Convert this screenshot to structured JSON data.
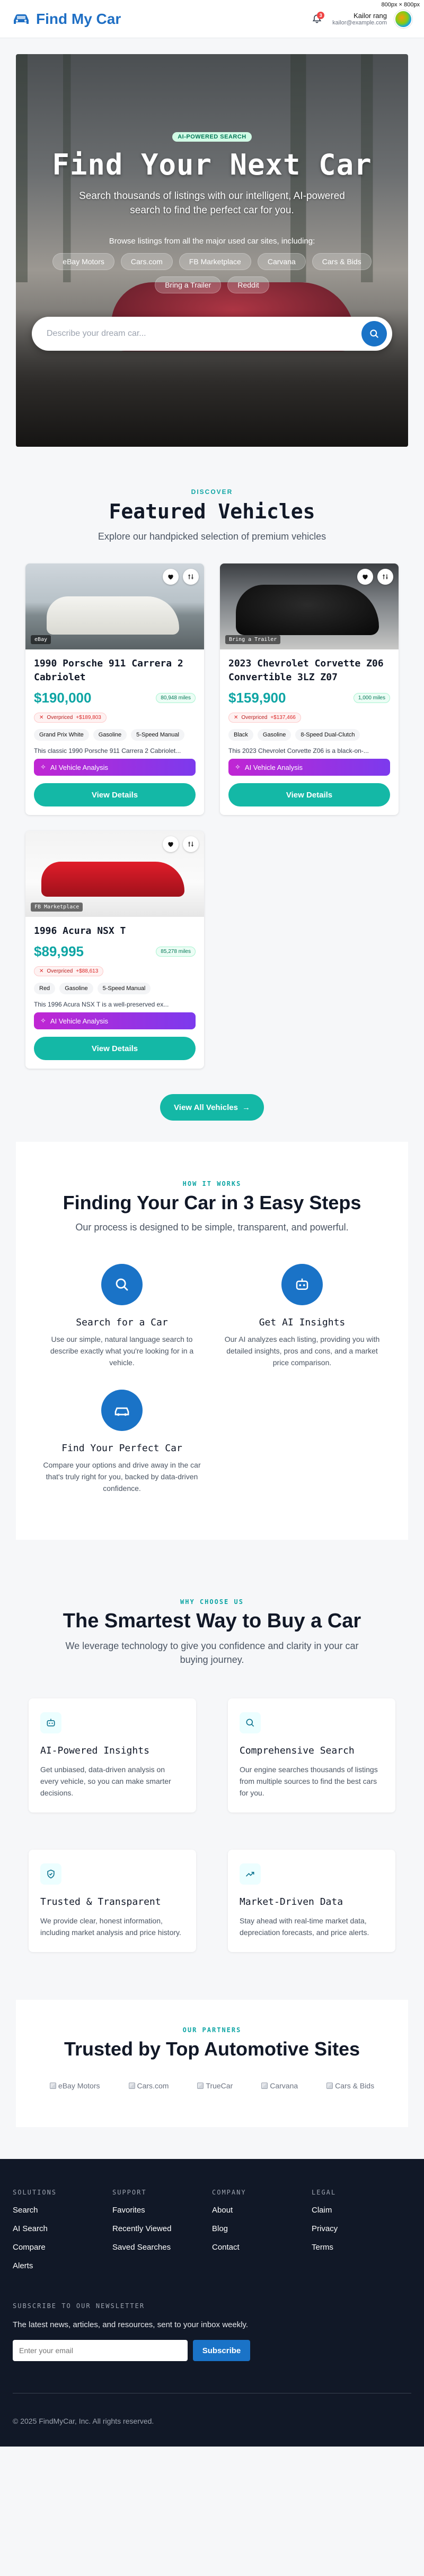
{
  "header": {
    "brand": "Find My Car",
    "notifications_count": "3",
    "user_name": "Kailor rang",
    "user_email": "kailor@example.com",
    "dim_note": "800px × 800px"
  },
  "hero": {
    "badge": "AI-POWERED SEARCH",
    "title": "Find Your Next Car",
    "subtitle": "Search thousands of listings with our intelligent, AI-powered search to find the perfect car for you.",
    "browse_label": "Browse listings from all the major used car sites, including:",
    "sites": [
      "eBay Motors",
      "Cars.com",
      "FB Marketplace",
      "Carvana",
      "Cars & Bids",
      "Bring a Trailer",
      "Reddit"
    ],
    "search_placeholder": "Describe your dream car..."
  },
  "featured": {
    "eyebrow": "DISCOVER",
    "title": "Featured Vehicles",
    "subtitle": "Explore our handpicked selection of premium vehicles",
    "ai_label": "AI Vehicle Analysis",
    "view_label": "View Details",
    "view_all": "View All Vehicles",
    "cars": [
      {
        "source": "eBay",
        "title": "1990 Porsche 911 Carrera 2 Cabriolet",
        "price": "$190,000",
        "miles": "80,948 miles",
        "overpriced": "Overpriced",
        "over_amount": "+$189,803",
        "tags": [
          "Grand Prix White",
          "Gasoline",
          "5-Speed Manual"
        ],
        "desc": "This classic 1990 Porsche 911 Carrera 2 Cabriolet..."
      },
      {
        "source": "Bring a Trailer",
        "title": "2023 Chevrolet Corvette Z06 Convertible 3LZ Z07",
        "price": "$159,900",
        "miles": "1,000 miles",
        "overpriced": "Overpriced",
        "over_amount": "+$137,466",
        "tags": [
          "Black",
          "Gasoline",
          "8-Speed Dual-Clutch"
        ],
        "desc": "This 2023 Chevrolet Corvette Z06 is a black-on-..."
      },
      {
        "source": "FB Marketplace",
        "title": "1996 Acura NSX T",
        "price": "$89,995",
        "miles": "85,278 miles",
        "overpriced": "Overpriced",
        "over_amount": "+$88,613",
        "tags": [
          "Red",
          "Gasoline",
          "5-Speed Manual"
        ],
        "desc": "This 1996 Acura NSX T is a well-preserved ex..."
      }
    ]
  },
  "how": {
    "eyebrow": "HOW IT WORKS",
    "title": "Finding Your Car in 3 Easy Steps",
    "subtitle": "Our process is designed to be simple, transparent, and powerful.",
    "steps": [
      {
        "title": "Search for a Car",
        "text": "Use our simple, natural language search to describe exactly what you're looking for in a vehicle."
      },
      {
        "title": "Get AI Insights",
        "text": "Our AI analyzes each listing, providing you with detailed insights, pros and cons, and a market price comparison."
      },
      {
        "title": "Find Your Perfect Car",
        "text": "Compare your options and drive away in the car that's truly right for you, backed by data-driven confidence."
      }
    ]
  },
  "why": {
    "eyebrow": "WHY CHOOSE US",
    "title": "The Smartest Way to Buy a Car",
    "subtitle": "We leverage technology to give you confidence and clarity in your car buying journey.",
    "features": [
      {
        "title": "AI-Powered Insights",
        "text": "Get unbiased, data-driven analysis on every vehicle, so you can make smarter decisions."
      },
      {
        "title": "Comprehensive Search",
        "text": "Our engine searches thousands of listings from multiple sources to find the best cars for you."
      },
      {
        "title": "Trusted & Transparent",
        "text": "We provide clear, honest information, including market analysis and price history."
      },
      {
        "title": "Market-Driven Data",
        "text": "Stay ahead with real-time market data, depreciation forecasts, and price alerts."
      }
    ]
  },
  "partners": {
    "eyebrow": "OUR PARTNERS",
    "title": "Trusted by Top Automotive Sites",
    "logos": [
      "eBay Motors",
      "Cars.com",
      "TrueCar",
      "Carvana",
      "Cars & Bids"
    ]
  },
  "footer": {
    "cols": [
      {
        "title": "SOLUTIONS",
        "links": [
          "Search",
          "AI Search",
          "Compare",
          "Alerts"
        ]
      },
      {
        "title": "SUPPORT",
        "links": [
          "Favorites",
          "Recently Viewed",
          "Saved Searches"
        ]
      },
      {
        "title": "COMPANY",
        "links": [
          "About",
          "Blog",
          "Contact"
        ]
      },
      {
        "title": "LEGAL",
        "links": [
          "Claim",
          "Privacy",
          "Terms"
        ]
      }
    ],
    "newsletter_title": "SUBSCRIBE TO OUR NEWSLETTER",
    "newsletter_text": "The latest news, articles, and resources, sent to your inbox weekly.",
    "email_placeholder": "Enter your email",
    "subscribe": "Subscribe",
    "copyright": "© 2025 FindMyCar, Inc. All rights reserved."
  }
}
